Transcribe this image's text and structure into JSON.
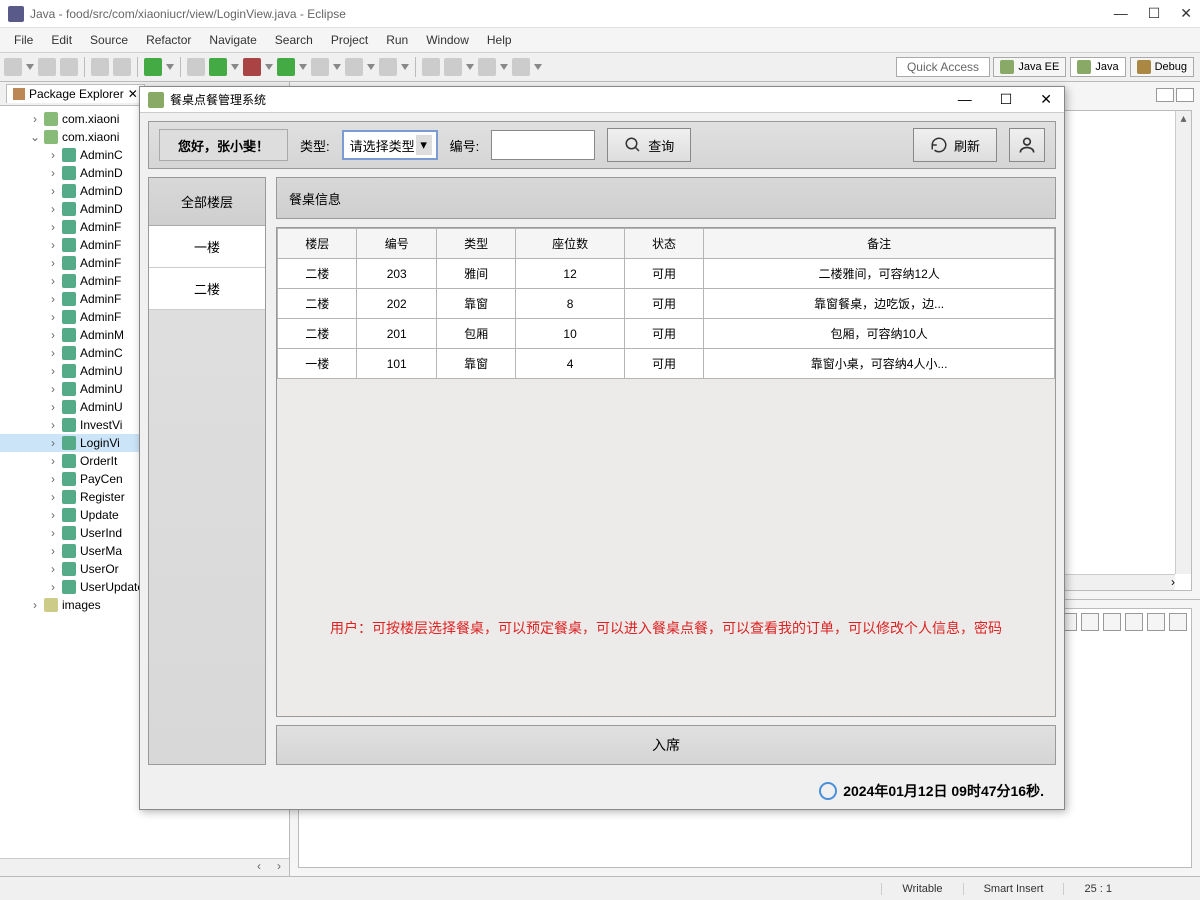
{
  "eclipse": {
    "title": "Java - food/src/com/xiaoniucr/view/LoginView.java - Eclipse",
    "menu": [
      "File",
      "Edit",
      "Source",
      "Refactor",
      "Navigate",
      "Search",
      "Project",
      "Run",
      "Window",
      "Help"
    ],
    "quickAccess": "Quick Access",
    "perspectives": [
      "Java EE",
      "Java",
      "Debug"
    ],
    "pkgExplorer": "Package Explorer",
    "tree": {
      "pkg1": "com.xiaoni",
      "pkg2": "com.xiaoni",
      "files": [
        "AdminC",
        "AdminD",
        "AdminD",
        "AdminD",
        "AdminF",
        "AdminF",
        "AdminF",
        "AdminF",
        "AdminF",
        "AdminF",
        "AdminM",
        "AdminC",
        "AdminU",
        "AdminU",
        "AdminU",
        "InvestVi",
        "LoginVi",
        "OrderIt",
        "PayCen",
        "Register",
        "Update",
        "UserInd",
        "UserMa",
        "UserOr",
        "UserUpdateProfileView.java"
      ],
      "images": "images"
    },
    "status": {
      "writable": "Writable",
      "insert": "Smart Insert",
      "pos": "25 : 1"
    }
  },
  "dialog": {
    "title": "餐桌点餐管理系统",
    "greet": "您好，张小斐！",
    "typeLabel": "类型:",
    "typePlaceholder": "请选择类型",
    "numLabel": "编号:",
    "searchBtn": "查询",
    "refreshBtn": "刷新",
    "floorsHdr": "全部楼层",
    "floors": [
      "一楼",
      "二楼"
    ],
    "contentHdr": "餐桌信息",
    "columns": [
      "楼层",
      "编号",
      "类型",
      "座位数",
      "状态",
      "备注"
    ],
    "rows": [
      {
        "floor": "二楼",
        "num": "203",
        "type": "雅间",
        "seats": "12",
        "status": "可用",
        "note": "二楼雅间，可容纳12人"
      },
      {
        "floor": "二楼",
        "num": "202",
        "type": "靠窗",
        "seats": "8",
        "status": "可用",
        "note": "靠窗餐桌，边吃饭，边..."
      },
      {
        "floor": "二楼",
        "num": "201",
        "type": "包厢",
        "seats": "10",
        "status": "可用",
        "note": "包厢，可容纳10人"
      },
      {
        "floor": "一楼",
        "num": "101",
        "type": "靠窗",
        "seats": "4",
        "status": "可用",
        "note": "靠窗小桌，可容纳4人小..."
      }
    ],
    "hint": "用户：可按楼层选择餐桌，可以预定餐桌，可以进入餐桌点餐，可以查看我的订单，可以修改个人信息，密码",
    "seatBtn": "入席",
    "timestamp": "2024年01月12日 09时47分16秒."
  }
}
